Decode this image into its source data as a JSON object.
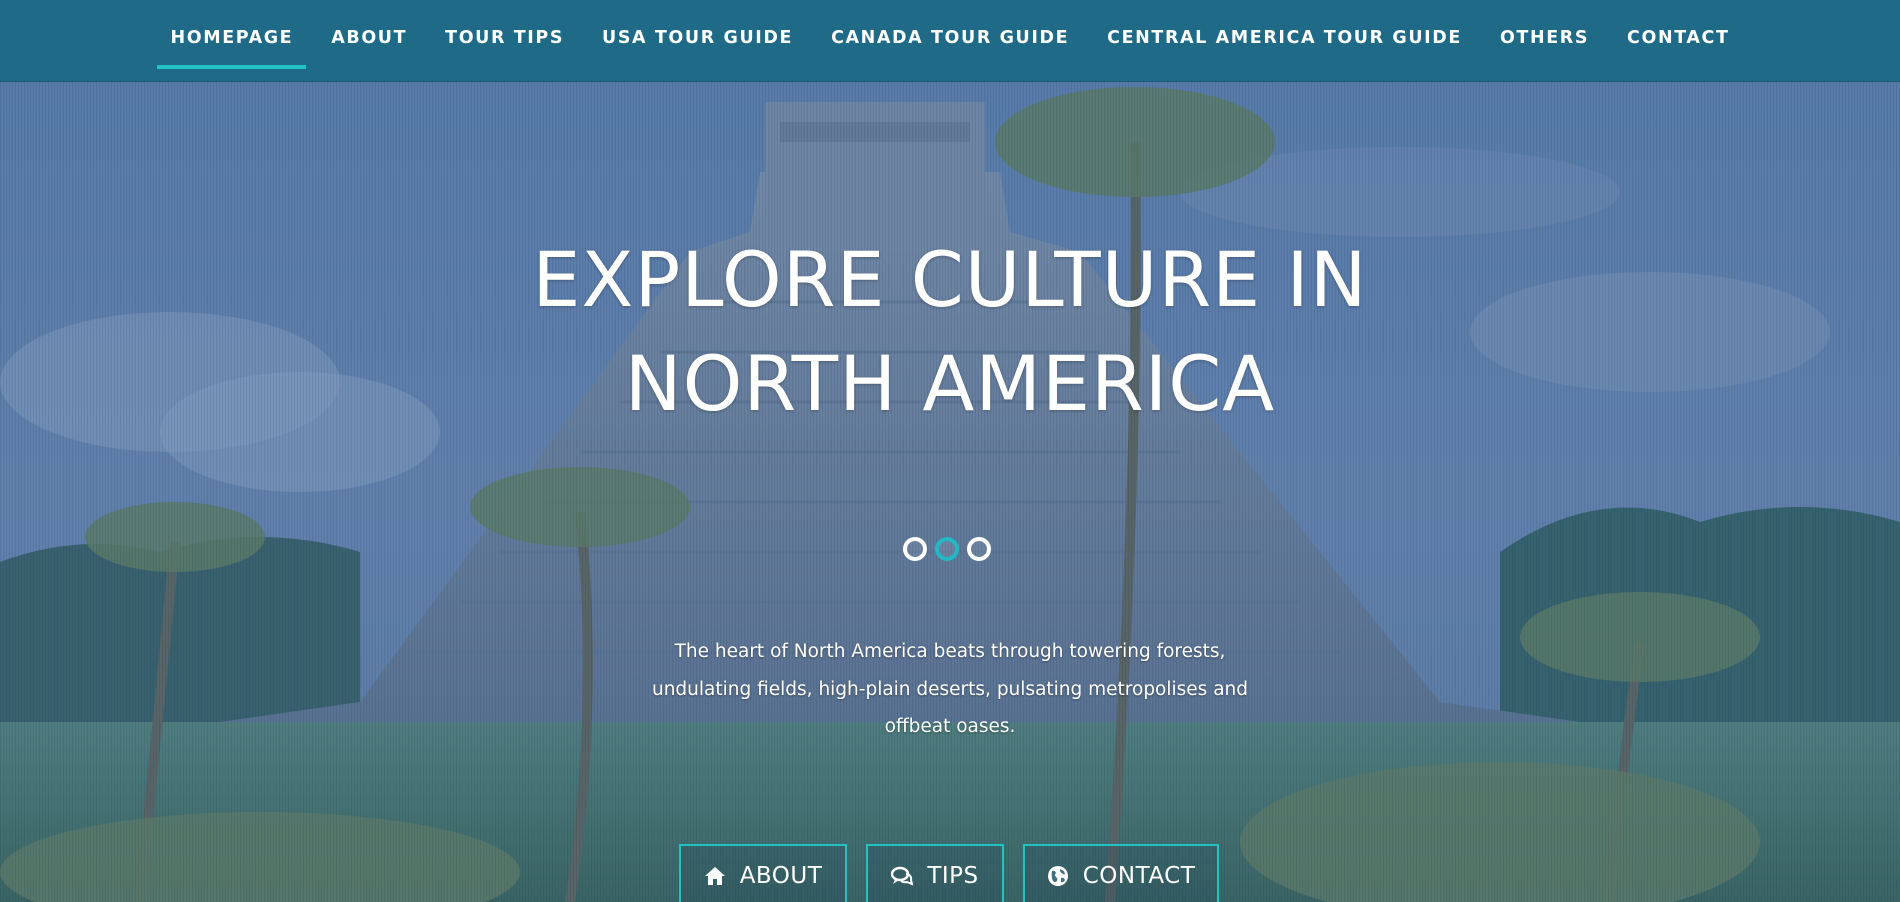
{
  "nav": {
    "items": [
      {
        "label": "HOMEPAGE",
        "active": true
      },
      {
        "label": "ABOUT",
        "active": false
      },
      {
        "label": "TOUR TIPS",
        "active": false
      },
      {
        "label": "USA TOUR GUIDE",
        "active": false
      },
      {
        "label": "CANADA TOUR GUIDE",
        "active": false
      },
      {
        "label": "CENTRAL AMERICA TOUR GUIDE",
        "active": false
      },
      {
        "label": "OTHERS",
        "active": false
      },
      {
        "label": "CONTACT",
        "active": false
      }
    ]
  },
  "hero": {
    "title_line1": "EXPLORE CULTURE IN",
    "title_line2": "NORTH AMERICA",
    "description_line1": "The heart of North America beats through towering forests,",
    "description_line2": "undulating fields, high-plain deserts, pulsating metropolises and",
    "description_line3": "offbeat oases.",
    "slider": {
      "count": 3,
      "active_index": 1
    },
    "buttons": [
      {
        "label": "ABOUT",
        "icon": "home-icon"
      },
      {
        "label": "TIPS",
        "icon": "comments-icon"
      },
      {
        "label": "CONTACT",
        "icon": "globe-icon"
      }
    ]
  },
  "colors": {
    "nav_bg": "#1e6a87",
    "accent": "#21c3c6",
    "text": "#ffffff"
  }
}
